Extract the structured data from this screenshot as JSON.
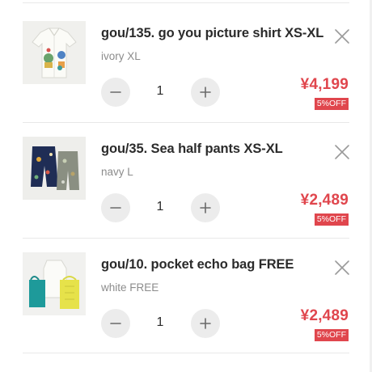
{
  "cart": {
    "items": [
      {
        "name": "gou/135. go you picture shirt XS-XL",
        "variant": "ivory XL",
        "quantity": "1",
        "price": "¥4,199",
        "discount_badge": "5%OFF",
        "thumbnail_icon": "shirt-product-photo"
      },
      {
        "name": "gou/35. Sea half pants XS-XL",
        "variant": "navy L",
        "quantity": "1",
        "price": "¥2,489",
        "discount_badge": "5%OFF",
        "thumbnail_icon": "pants-product-photo"
      },
      {
        "name": "gou/10. pocket echo bag FREE",
        "variant": "white FREE",
        "quantity": "1",
        "price": "¥2,489",
        "discount_badge": "5%OFF",
        "thumbnail_icon": "bag-product-photo"
      }
    ]
  },
  "icons": {
    "remove": "close-icon",
    "decrease": "minus-icon",
    "increase": "plus-icon"
  },
  "colors": {
    "price": "#e0464d",
    "badge_bg": "#e0464d",
    "qty_button_bg": "#ececec",
    "title": "#2b2b2b",
    "variant": "#8c8c8c"
  }
}
